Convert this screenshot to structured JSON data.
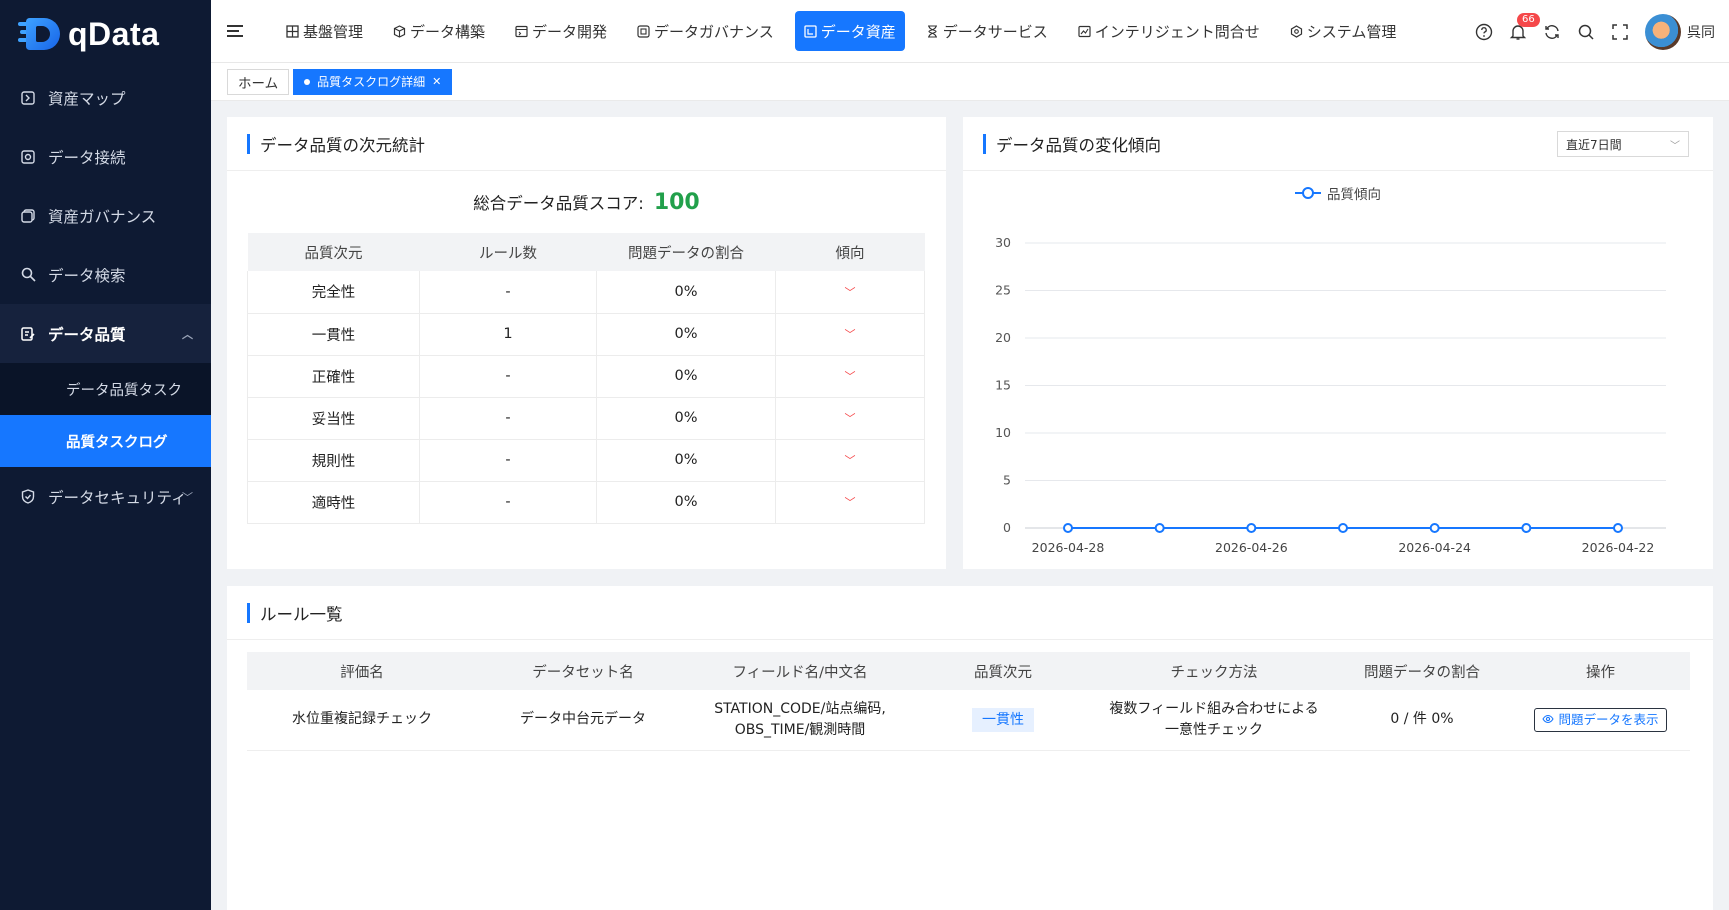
{
  "app": {
    "name": "qData"
  },
  "sidebar": {
    "items": [
      {
        "label": "資産マップ"
      },
      {
        "label": "データ接続"
      },
      {
        "label": "資産ガバナンス"
      },
      {
        "label": "データ検索"
      },
      {
        "label": "データ品質"
      },
      {
        "label": "データセキュリティ"
      }
    ],
    "sub_items": [
      {
        "label": "データ品質タスク"
      },
      {
        "label": "品質タスクログ"
      }
    ]
  },
  "header": {
    "nav": [
      {
        "label": "基盤管理"
      },
      {
        "label": "データ構築"
      },
      {
        "label": "データ開発"
      },
      {
        "label": "データガバナンス"
      },
      {
        "label": "データ資産"
      },
      {
        "label": "データサービス"
      },
      {
        "label": "インテリジェント問合せ"
      },
      {
        "label": "システム管理"
      }
    ],
    "notification_count": "66",
    "user_name": "呉同"
  },
  "tabs": [
    {
      "label": "ホーム"
    },
    {
      "label": "品質タスクログ詳細"
    }
  ],
  "stats_card": {
    "title": "データ品質の次元統計",
    "score_label": "総合データ品質スコア:",
    "score_value": "100",
    "columns": [
      "品質次元",
      "ルール数",
      "問題データの割合",
      "傾向"
    ],
    "rows": [
      {
        "dimension": "完全性",
        "rules": "-",
        "ratio": "0%"
      },
      {
        "dimension": "一貫性",
        "rules": "1",
        "ratio": "0%"
      },
      {
        "dimension": "正確性",
        "rules": "-",
        "ratio": "0%"
      },
      {
        "dimension": "妥当性",
        "rules": "-",
        "ratio": "0%"
      },
      {
        "dimension": "規則性",
        "rules": "-",
        "ratio": "0%"
      },
      {
        "dimension": "適時性",
        "rules": "-",
        "ratio": "0%"
      }
    ]
  },
  "trend_card": {
    "title": "データ品質の変化傾向",
    "period": "直近7日間",
    "accent": "#1677ff"
  },
  "chart_data": {
    "type": "line",
    "title": "",
    "xlabel": "",
    "ylabel": "",
    "ylim": [
      0,
      30
    ],
    "yticks": [
      0,
      5,
      10,
      15,
      20,
      25,
      30
    ],
    "x": [
      "2026-04-28",
      "2026-04-27",
      "2026-04-26",
      "2026-04-25",
      "2026-04-24",
      "2026-04-23",
      "2026-04-22"
    ],
    "xtick_labels": [
      "2026-04-28",
      "2026-04-26",
      "2026-04-24",
      "2026-04-22"
    ],
    "series": [
      {
        "name": "品質傾向",
        "values": [
          0,
          0,
          0,
          0,
          0,
          0,
          0
        ]
      }
    ],
    "legend": "top-center",
    "grid": true
  },
  "rules_card": {
    "title": "ルール一覧",
    "columns": [
      "評価名",
      "データセット名",
      "フィールド名/中文名",
      "品質次元",
      "チェック方法",
      "問題データの割合",
      "操作"
    ],
    "rows": [
      {
        "name": "水位重複記録チェック",
        "dataset": "データ中台元データ",
        "field_line1": "STATION_CODE/站点编码,",
        "field_line2": "OBS_TIME/観測時間",
        "dimension": "一貫性",
        "method_line1": "複数フィールド組み合わせによる",
        "method_line2": "一意性チェック",
        "ratio": "0 / 件 0%",
        "action": "問題データを表示"
      }
    ]
  }
}
